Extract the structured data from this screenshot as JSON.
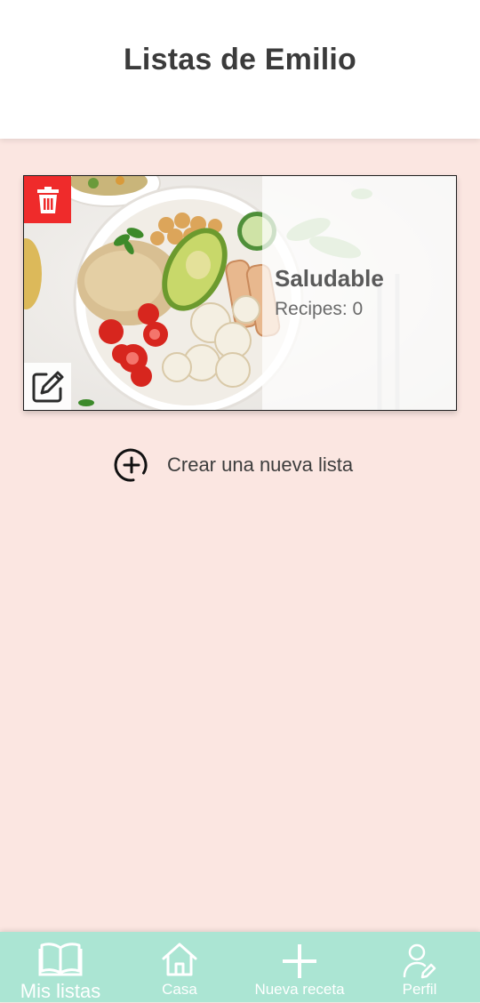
{
  "header": {
    "title": "Listas de Emilio"
  },
  "lists": [
    {
      "name": "Saludable",
      "recipes_label": "Recipes: 0"
    }
  ],
  "create_list": {
    "label": "Crear una nueva lista",
    "icon": "plus-circle-icon"
  },
  "card_actions": {
    "delete_icon": "trash-icon",
    "edit_icon": "edit-icon"
  },
  "bottom_nav": {
    "items": [
      {
        "label": "Mis listas",
        "icon": "book-icon",
        "active": true
      },
      {
        "label": "Casa",
        "icon": "home-icon",
        "active": false
      },
      {
        "label": "Nueva receta",
        "icon": "plus-icon",
        "active": false
      },
      {
        "label": "Perfil",
        "icon": "user-edit-icon",
        "active": false
      }
    ]
  },
  "colors": {
    "background": "#fbe6e1",
    "header": "#ffffff",
    "nav": "#abe5d3",
    "delete": "#ef2b2b",
    "text": "#3b3b3b"
  }
}
